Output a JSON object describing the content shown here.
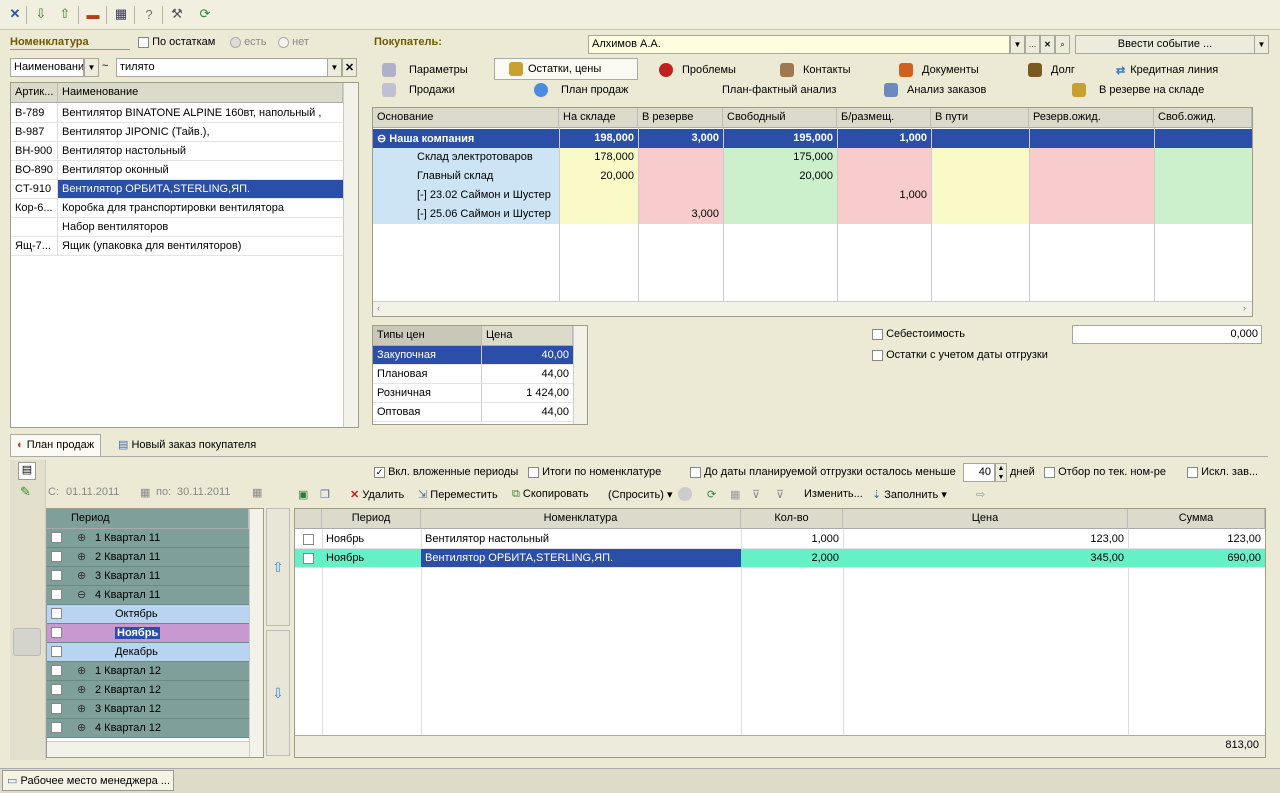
{
  "nomenclature": {
    "title": "Номенклатура",
    "only_stock_label": "По остаткам",
    "radio_yes": "есть",
    "radio_no": "нет",
    "search_field_value": "Наименовани",
    "search_operator": "~",
    "search_text": "тилято",
    "col_article": "Артик...",
    "col_name": "Наименование",
    "rows": [
      {
        "article": "B-789",
        "name": "Вентилятор BINATONE ALPINE 160вт, напольный ,"
      },
      {
        "article": "B-987",
        "name": "Вентилятор JIPONIC (Тайв.),"
      },
      {
        "article": "BH-900",
        "name": "Вентилятор настольный"
      },
      {
        "article": "BO-890",
        "name": "Вентилятор оконный"
      },
      {
        "article": "CT-910",
        "name": "Вентилятор ОРБИТА,STERLING,ЯП."
      },
      {
        "article": "Кор-6...",
        "name": "Коробка для транспортировки вентилятора"
      },
      {
        "article": "",
        "name": "Набор вентиляторов"
      },
      {
        "article": "Ящ-7...",
        "name": "Ящик (упаковка для вентиляторов)"
      }
    ]
  },
  "buyer": {
    "label": "Покупатель:",
    "value": "Алхимов А.А.",
    "event_button": "Ввести событие ..."
  },
  "tabs_row1": [
    "Параметры",
    "Остатки, цены",
    "Проблемы",
    "Контакты",
    "Документы",
    "Долг",
    "Кредитная линия"
  ],
  "tabs_row2": [
    "Продажи",
    "План продаж",
    "План-фактный анализ",
    "Анализ заказов",
    "В резерве на складе"
  ],
  "stock": {
    "headers": [
      "Основание",
      "На складе",
      "В резерве",
      "Свободный",
      "Б/размещ.",
      "В пути",
      "Резерв.ожид.",
      "Своб.ожид."
    ],
    "group": {
      "name": "Наша компания",
      "on_stock": "198,000",
      "reserved": "3,000",
      "free": "195,000",
      "unplaced": "1,000"
    },
    "rows": [
      {
        "name": "Склад электротоваров",
        "on_stock": "178,000",
        "reserved": "",
        "free": "175,000",
        "unplaced": ""
      },
      {
        "name": "Главный склад",
        "on_stock": "20,000",
        "reserved": "",
        "free": "20,000",
        "unplaced": ""
      },
      {
        "name": "[-] 23.02 Саймон и Шустер",
        "on_stock": "",
        "reserved": "",
        "free": "",
        "unplaced": "1,000"
      },
      {
        "name": "[-] 25.06 Саймон и Шустер",
        "on_stock": "",
        "reserved": "3,000",
        "free": "",
        "unplaced": ""
      }
    ]
  },
  "prices": {
    "col_type": "Типы цен",
    "col_price": "Цена",
    "rows": [
      {
        "type": "Закупочная",
        "price": "40,00"
      },
      {
        "type": "Плановая",
        "price": "44,00"
      },
      {
        "type": "Розничная",
        "price": "1 424,00"
      },
      {
        "type": "Оптовая",
        "price": "44,00"
      }
    ]
  },
  "cost_label": "Себестоимость",
  "cost_value": "0,000",
  "shipdate_label": "Остатки с учетом даты отгрузки",
  "bottom_tabs": [
    "План продаж",
    "Новый заказ покупателя"
  ],
  "period": {
    "from_label": "С:",
    "from": "01.11.2011",
    "to_label": "по:",
    "to": "30.11.2011",
    "col": "Период",
    "rows": [
      {
        "label": "1 Квартал 11",
        "kind": "q",
        "sign": "⊕"
      },
      {
        "label": "2 Квартал 11",
        "kind": "q",
        "sign": "⊕"
      },
      {
        "label": "3 Квартал 11",
        "kind": "q",
        "sign": "⊕"
      },
      {
        "label": "4 Квартал 11",
        "kind": "q",
        "sign": "⊖"
      },
      {
        "label": "Октябрь",
        "kind": "m",
        "sign": ""
      },
      {
        "label": "Ноябрь",
        "kind": "sel",
        "sign": ""
      },
      {
        "label": "Декабрь",
        "kind": "m",
        "sign": ""
      },
      {
        "label": "1 Квартал 12",
        "kind": "q",
        "sign": "⊕"
      },
      {
        "label": "2 Квартал 12",
        "kind": "q",
        "sign": "⊕"
      },
      {
        "label": "3 Квартал 12",
        "kind": "q",
        "sign": "⊕"
      },
      {
        "label": "4 Квартал 12",
        "kind": "q",
        "sign": "⊕"
      }
    ]
  },
  "plan_options": {
    "nested": "Вкл. вложенные периоды",
    "totals": "Итоги по номенклатуре",
    "until": "До даты планируемой отгрузки осталось меньше",
    "days_value": "40",
    "days": "дней",
    "filter": "Отбор по тек. ном-ре",
    "excl": "Искл. зав..."
  },
  "plan_toolbar": {
    "delete": "Удалить",
    "move": "Переместить",
    "copy": "Скопировать",
    "ask": "(Спросить)",
    "change": "Изменить...",
    "fill": "Заполнить"
  },
  "plan_table": {
    "headers": [
      "Период",
      "Номенклатура",
      "Кол-во",
      "Цена",
      "Сумма"
    ],
    "rows": [
      {
        "period": "Ноябрь",
        "item": "Вентилятор настольный",
        "qty": "1,000",
        "price": "123,00",
        "sum": "123,00"
      },
      {
        "period": "Ноябрь",
        "item": "Вентилятор ОРБИТА,STERLING,ЯП.",
        "qty": "2,000",
        "price": "345,00",
        "sum": "690,00"
      }
    ],
    "total": "813,00"
  },
  "taskbar_item": "Рабочее место менеджера ..."
}
